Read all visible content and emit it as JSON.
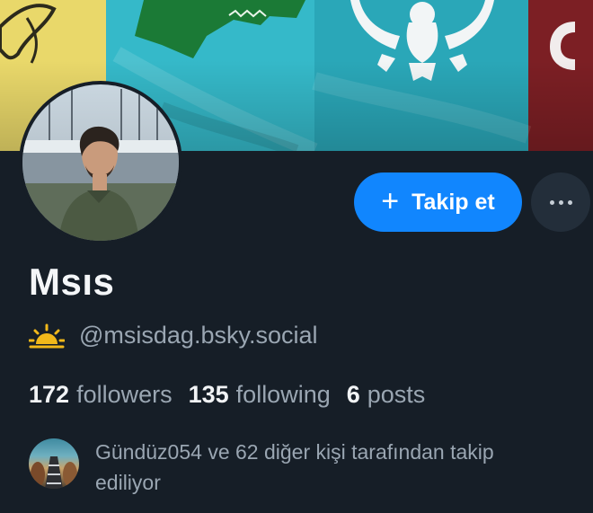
{
  "profile": {
    "display_name": "Msıs",
    "handle": "@msisdag.bsky.social",
    "handle_icon": "sun-icon"
  },
  "actions": {
    "follow_label": "Takip et",
    "follow_icon": "plus-icon",
    "more_icon": "more-options-icon"
  },
  "stats": {
    "followers_count": "172",
    "followers_label": "followers",
    "following_count": "135",
    "following_label": "following",
    "posts_count": "6",
    "posts_label": "posts"
  },
  "followed_by": {
    "text": "Gündüz054 ve 62 diğer kişi tarafından takip ediliyor"
  },
  "colors": {
    "background": "#161e27",
    "accent": "#1186fe",
    "muted_text": "#9aa6b2",
    "primary_text": "#f1f3f5"
  }
}
